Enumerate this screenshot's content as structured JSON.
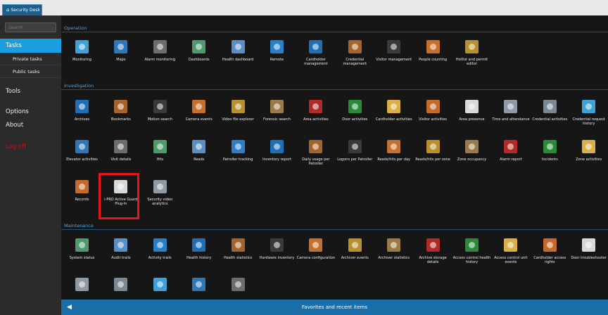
{
  "app_tab": {
    "icon": "home-icon",
    "label": "Security Desk"
  },
  "search": {
    "placeholder": "Search"
  },
  "nav": {
    "tasks": "Tasks",
    "private_tasks": "Private tasks",
    "public_tasks": "Public tasks",
    "tools": "Tools",
    "options": "Options",
    "about": "About",
    "logoff": "Log off"
  },
  "sections": {
    "operation": "Operation",
    "investigation": "Investigation",
    "maintenance": "Maintenance"
  },
  "operation_tiles": [
    "Monitoring",
    "Maps",
    "Alarm monitoring",
    "Dashboards",
    "Health dashboard",
    "Remote",
    "Cardholder management",
    "Credential management",
    "Visitor management",
    "People counting",
    "Hotlist and permit editor"
  ],
  "investigation_tiles": [
    "Archives",
    "Bookmarks",
    "Motion search",
    "Camera events",
    "Video file explorer",
    "Forensic search",
    "Area activities",
    "Door activities",
    "Cardholder activities",
    "Visitor activities",
    "Area presence",
    "Time and attendance",
    "Credential activities",
    "Credential request history",
    "Elevator activities",
    "Visit details",
    "Hits",
    "Reads",
    "Patroller tracking",
    "Inventory report",
    "Daily usage per Patroller",
    "Logons per Patroller",
    "Reads/hits per day",
    "Reads/hits per zone",
    "Zone occupancy",
    "Alarm report",
    "Incidents",
    "Zone activities",
    "Records",
    "i-PRO Active Guard Plug-in",
    "Security video analytics"
  ],
  "maintenance_tiles": [
    "System status",
    "Audit trails",
    "Activity trails",
    "Health history",
    "Health statistics",
    "Hardware inventory",
    "Camera configuration",
    "Archiver events",
    "Archiver statistics",
    "Archive storage details",
    "Access control health history",
    "Access control unit events",
    "Cardholder access rights",
    "Door troubleshooter",
    "",
    "",
    "",
    "",
    ""
  ],
  "highlighted_tile": "i-PRO Active Guard Plug-in",
  "highlight_color": "#e8161a",
  "accent_color": "#1b9ee0",
  "favorites": {
    "label": "Favorites and recent items",
    "arrow_icon": "left-arrow-icon"
  }
}
